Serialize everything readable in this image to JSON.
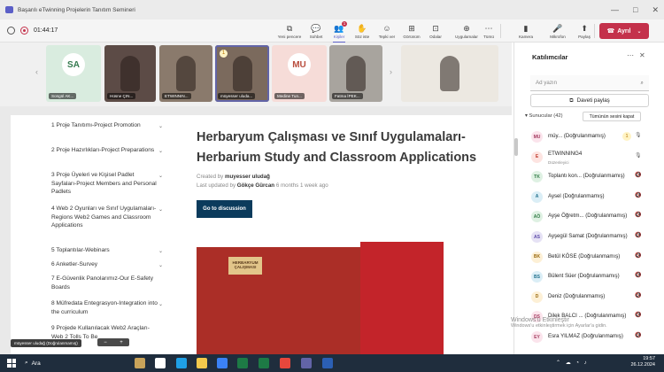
{
  "window": {
    "title": "Başarılı eTwinning Projelerin Tanıtım Semineri",
    "controls": [
      "—",
      "□",
      "✕"
    ]
  },
  "toolbar": {
    "timer": "01:44:17",
    "buttons": [
      {
        "label": "Yeni pencere",
        "icon": "new-window-icon",
        "glyph": "⧉"
      },
      {
        "label": "Sohbet",
        "icon": "chat-icon",
        "glyph": "💬"
      },
      {
        "label": "Kişiler",
        "icon": "people-icon",
        "glyph": "👥",
        "badge": "1",
        "active": true
      },
      {
        "label": "Söz iste",
        "icon": "raise-hand-icon",
        "glyph": "✋"
      },
      {
        "label": "Tepki ver",
        "icon": "react-icon",
        "glyph": "☺"
      },
      {
        "label": "Görünüm",
        "icon": "view-icon",
        "glyph": "⊞"
      },
      {
        "label": "Odalar",
        "icon": "rooms-icon",
        "glyph": "⊡"
      },
      {
        "label": "Uygulamalar",
        "icon": "apps-icon",
        "glyph": "⊕"
      },
      {
        "label": "Tümü",
        "icon": "more-icon",
        "glyph": "⋯"
      },
      {
        "label": "Kamera",
        "icon": "camera-icon",
        "glyph": "▮"
      },
      {
        "label": "Mikrofon",
        "icon": "mic-icon",
        "glyph": "🎤"
      },
      {
        "label": "Paylaş",
        "icon": "share-icon",
        "glyph": "⬆"
      }
    ],
    "leave_label": "Ayrıl"
  },
  "strip": {
    "tiles": [
      {
        "name": "Songül AK...",
        "initials": "SA",
        "bg": "#d9ecdf",
        "fg": "#357a4f",
        "kind": "avatar"
      },
      {
        "name": "Hüsne ÇIN...",
        "bg": "#5c4b46",
        "kind": "video"
      },
      {
        "name": "ETWINNIN...",
        "bg": "#8a7a6c",
        "kind": "video"
      },
      {
        "name": "müyesser uluda...",
        "bg": "#7b6a5d",
        "kind": "video",
        "speaking": true,
        "hand": "1"
      },
      {
        "name": "Medine Tun...",
        "initials": "MU",
        "bg": "#f6dcd8",
        "fg": "#b94d3d",
        "kind": "avatar"
      },
      {
        "name": "Fatma İPEK...",
        "bg": "#a8a49e",
        "kind": "video"
      },
      {
        "name": "",
        "bg": "#ece8e1",
        "kind": "video-large"
      }
    ]
  },
  "document": {
    "toc": [
      {
        "text": "1 Proje Tanıtımı-Project Promotion",
        "chev": true
      },
      {
        "text": "2 Proje Hazırlıkları-Project Preparations",
        "chev": true
      },
      {
        "text": "3 Proje Üyeleri ve Kişisel Padlet Sayfaları-Project Members and Personal Padlets",
        "chev": true
      },
      {
        "text": "4 Web 2 Oyunları ve Sınıf Uygulamaları-Regions Web2 Games and Classroom Applications",
        "chev": true
      },
      {
        "text": "5 Toplantılar-Webinars",
        "chev": true
      },
      {
        "text": "6 Anketler-Survey",
        "chev": true
      },
      {
        "text": "7 E-Güvenlik Panolarımız-Our E-Safety Boards",
        "chev": false
      },
      {
        "text": "8 Müfredata Entegrasyon-Integration into the curriculum",
        "chev": true
      },
      {
        "text": "9 Projede Kullanılacak Web2 Araçları-Web 2 Tolls To Be",
        "chev": false
      }
    ],
    "title_line1": "Herbaryum Çalışması ve Sınıf Uygulamaları-",
    "title_line2": "Herbarium Study and Classroom Applications",
    "created_prefix": "Created by",
    "created_by": "muyesser uludağ",
    "updated_prefix": "Last updated by",
    "updated_by": "Gökçe Gürcan",
    "updated_ago": "6 months 1 week ago",
    "discuss_button": "Go to discussion",
    "board_label": "HERBARYUM ÇALIŞMASI"
  },
  "presenter_tag": "müyesser uludağ (Doğrulanmamış)",
  "panel": {
    "title": "Katılımcılar",
    "search_placeholder": "Ad yazın",
    "share_invite": "Daveti paylaş",
    "section": "Sunucular (42)",
    "mute_all": "Tümünün sesini kapat",
    "participants": [
      {
        "initials": "MU",
        "name": "müy... (Doğrulanmamış)",
        "bg": "#fbe4ec",
        "fg": "#a33b5f",
        "mic": "on",
        "hand": "1"
      },
      {
        "initials": "E",
        "name": "ETWINNING4",
        "sub": "Düzenleyici",
        "bg": "#fde4e1",
        "fg": "#c0392b",
        "mic": "on"
      },
      {
        "initials": "TK",
        "name": "Toplantı kon... (Doğrulanmamış)",
        "bg": "#dff1e3",
        "fg": "#2f7a44",
        "mic": "off"
      },
      {
        "initials": "A",
        "name": "Aysel (Doğrulanmamış)",
        "bg": "#dbeef6",
        "fg": "#1f6f8b",
        "mic": "off"
      },
      {
        "initials": "AÖ",
        "name": "Ayşe Öğretm... (Doğrulanmamış)",
        "bg": "#dff1e3",
        "fg": "#2f7a44",
        "mic": "off"
      },
      {
        "initials": "AS",
        "name": "Ayşegül Samat (Doğrulanmamış)",
        "bg": "#e6e2f5",
        "fg": "#5b4aa8",
        "mic": "off"
      },
      {
        "initials": "BK",
        "name": "Betül KÖSE (Doğrulanmamış)",
        "bg": "#fdf0d6",
        "fg": "#9a6a10",
        "mic": "off"
      },
      {
        "initials": "BS",
        "name": "Bülent Süer (Doğrulanmamış)",
        "bg": "#dbeef6",
        "fg": "#1f6f8b",
        "mic": "off"
      },
      {
        "initials": "D",
        "name": "Deniz (Doğrulanmamış)",
        "bg": "#fdf0d6",
        "fg": "#9a6a10",
        "mic": "off"
      },
      {
        "initials": "DS",
        "name": "Dilek BALCI ... (Doğrulanmamış)",
        "bg": "#fbe4ec",
        "fg": "#a33b5f",
        "mic": "off"
      },
      {
        "initials": "EY",
        "name": "Esra YILMAZ (Doğrulanmamış)",
        "bg": "#fbe4ec",
        "fg": "#a33b5f",
        "mic": "off"
      }
    ]
  },
  "watermark": {
    "line1": "Windows'u Etkinleştir",
    "line2": "Windows'u etkinleştirmek için Ayarlar'a gidin."
  },
  "taskbar": {
    "search_label": "Ara",
    "time": "19:57",
    "date": "26.12.2024",
    "apps": [
      {
        "name": "news-widget-icon",
        "color": "#c8a35a"
      },
      {
        "name": "task-view-icon",
        "color": "#ffffff"
      },
      {
        "name": "edge-icon",
        "color": "#1fa0e6"
      },
      {
        "name": "explorer-icon",
        "color": "#f2c94c"
      },
      {
        "name": "store-icon",
        "color": "#3b82f6"
      },
      {
        "name": "excel-icon",
        "color": "#1d7a45"
      },
      {
        "name": "excel2-icon",
        "color": "#1d7a45"
      },
      {
        "name": "chrome-icon",
        "color": "#e7473c"
      },
      {
        "name": "teams-icon",
        "color": "#6264a7"
      },
      {
        "name": "word-icon",
        "color": "#2b5fb4"
      }
    ]
  }
}
